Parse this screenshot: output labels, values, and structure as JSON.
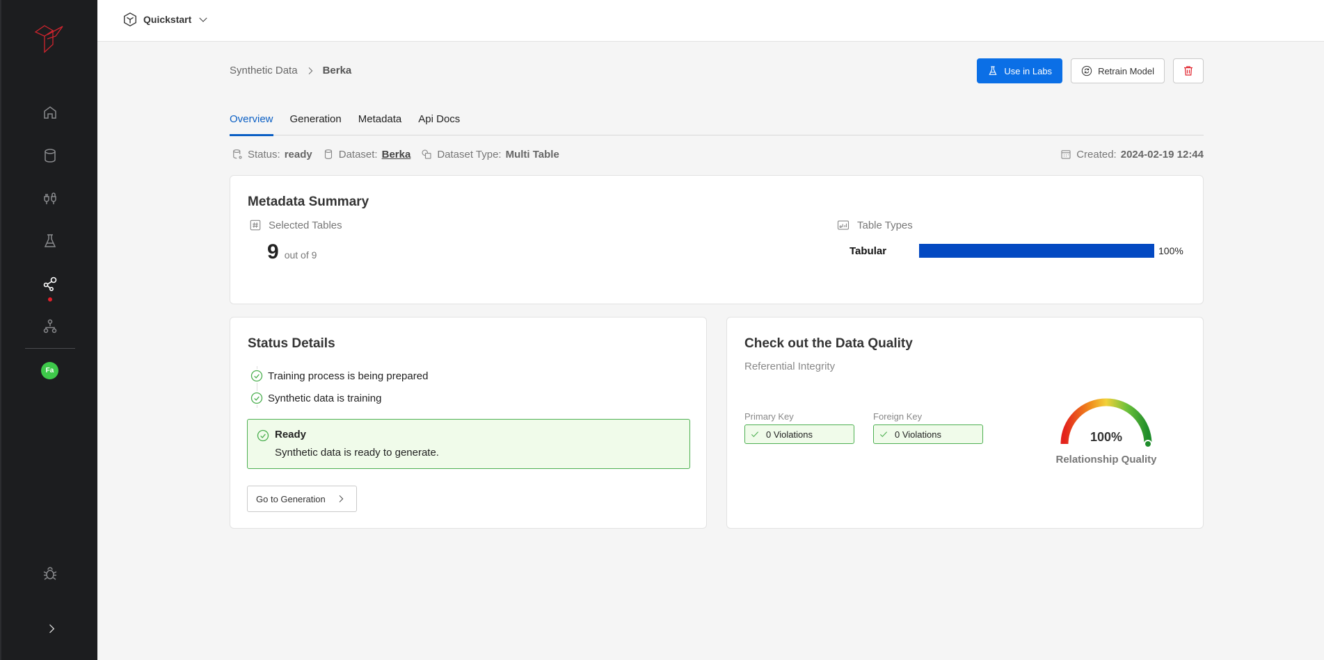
{
  "topbar": {
    "project_icon": "cube-icon",
    "project_name": "Quickstart"
  },
  "sidebar": {
    "items": [
      {
        "name": "home",
        "icon": "home-icon",
        "active": false
      },
      {
        "name": "datasets",
        "icon": "database-icon",
        "active": false
      },
      {
        "name": "connectors",
        "icon": "plug-icon",
        "active": false
      },
      {
        "name": "labs",
        "icon": "flask-icon",
        "active": false
      },
      {
        "name": "synthetic-data",
        "icon": "share-nodes-icon",
        "active": true
      },
      {
        "name": "pipelines",
        "icon": "hierarchy-icon",
        "active": false
      }
    ],
    "user_initials": "Fa",
    "avatar_color": "#3ec94a",
    "bottom_icon": "bug-icon",
    "accent_dot_color": "#e0202a"
  },
  "breadcrumb": {
    "parent": "Synthetic Data",
    "current": "Berka"
  },
  "actions": {
    "use_in_labs": "Use in Labs",
    "retrain_model": "Retrain Model",
    "delete_icon": "trash-icon"
  },
  "tabs": [
    {
      "label": "Overview",
      "active": true
    },
    {
      "label": "Generation",
      "active": false
    },
    {
      "label": "Metadata",
      "active": false
    },
    {
      "label": "Api Docs",
      "active": false
    }
  ],
  "meta": {
    "status_label": "Status:",
    "status_value": "ready",
    "dataset_label": "Dataset:",
    "dataset_value": "Berka",
    "dataset_type_label": "Dataset Type:",
    "dataset_type_value": "Multi Table",
    "created_label": "Created:",
    "created_value": "2024-02-19 12:44"
  },
  "metadata_summary": {
    "title": "Metadata Summary",
    "selected_tables_label": "Selected Tables",
    "selected_count": "9",
    "total_text": "out of 9",
    "table_types_label": "Table Types",
    "table_types": [
      {
        "name": "Tabular",
        "percent": 100,
        "percent_label": "100%"
      }
    ],
    "bar_color": "#0349c2"
  },
  "status_details": {
    "title": "Status Details",
    "steps": [
      "Training process is being prepared",
      "Synthetic data is training"
    ],
    "ready_title": "Ready",
    "ready_desc": "Synthetic data is ready to generate.",
    "go_button": "Go to Generation"
  },
  "data_quality": {
    "title": "Check out the Data Quality",
    "subtitle": "Referential Integrity",
    "primary_key_label": "Primary Key",
    "primary_key_value": "0 Violations",
    "foreign_key_label": "Foreign Key",
    "foreign_key_value": "0 Violations",
    "gauge_value": 100,
    "gauge_label": "100%",
    "gauge_caption": "Relationship Quality"
  },
  "colors": {
    "primary": "#0b6fe6",
    "tab_active": "#0b5fc4",
    "success": "#4caf50",
    "danger": "#e0202a"
  }
}
